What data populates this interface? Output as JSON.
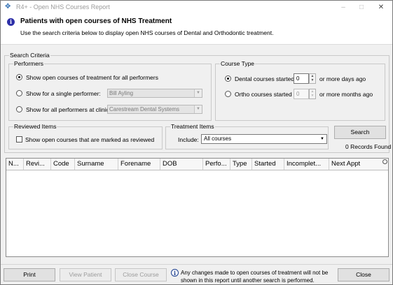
{
  "window": {
    "title": "R4+ - Open NHS Courses Report",
    "controls": [
      "minimize",
      "maximize",
      "close"
    ]
  },
  "header": {
    "title": "Patients with open courses of NHS Treatment",
    "subtitle": "Use the search criteria below to display open NHS courses of Dental and Orthodontic treatment."
  },
  "search_criteria": {
    "label": "Search Criteria",
    "performers": {
      "label": "Performers",
      "options": [
        {
          "label": "Show open courses of treatment for all performers",
          "selected": true
        },
        {
          "label": "Show for a single performer:",
          "selected": false,
          "value": "Bill Ayling"
        },
        {
          "label": "Show for all performers at clinic:",
          "selected": false,
          "value": "Carestream Dental Systems"
        }
      ]
    },
    "course_type": {
      "label": "Course Type",
      "dental": {
        "label": "Dental courses started",
        "value": "0",
        "suffix": "or more days ago",
        "selected": true
      },
      "ortho": {
        "label": "Ortho courses started",
        "value": "0",
        "suffix": "or more months ago",
        "selected": false
      }
    },
    "reviewed": {
      "label": "Reviewed Items",
      "checkbox_label": "Show open courses that are marked as reviewed",
      "checked": false
    },
    "treatment": {
      "label": "Treatment Items",
      "include_label": "Include:",
      "include_value": "All courses"
    },
    "search_button": "Search",
    "records_found": "0 Records Found"
  },
  "grid": {
    "columns": [
      "N...",
      "Revi...",
      "Code",
      "Surname",
      "Forename",
      "DOB",
      "Perfo...",
      "Type",
      "Started",
      "Incomplet...",
      "Next Appt"
    ],
    "rows": []
  },
  "footer": {
    "print": "Print",
    "view_patient": "View Patient",
    "close_course": "Close Course",
    "note": "Any changes made to open courses of treatment will not be shown in this report until another search is performed.",
    "close": "Close"
  }
}
